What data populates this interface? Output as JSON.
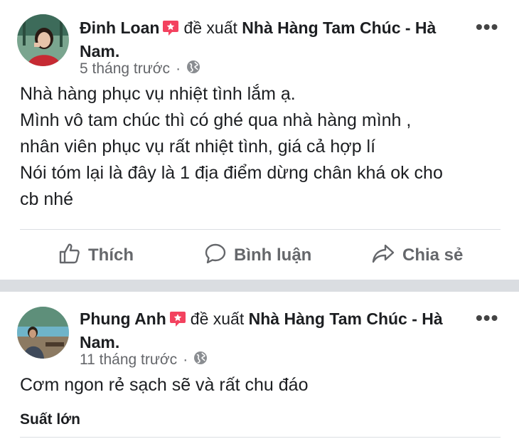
{
  "posts": [
    {
      "author": "Đinh Loan",
      "verb": "đề xuất",
      "place": "Nhà Hàng Tam Chúc - Hà Nam.",
      "time": "5 tháng trước",
      "separator": "·",
      "icons": {
        "recommend": "recommend-badge-icon",
        "privacy": "globe-icon",
        "more": "more-options-icon"
      },
      "body_lines": [
        "Nhà hàng phục vụ nhiệt tình lắm ạ.",
        "Mình vô tam chúc thì có ghé qua nhà hàng mình ,",
        "nhân viên phục vụ rất nhiệt tình, giá cả hợp lí",
        "Nói tóm lại là đây là 1 địa điểm dừng chân khá ok cho",
        "cb nhé"
      ]
    },
    {
      "author": "Phung Anh",
      "verb": "đề xuất",
      "place": "Nhà Hàng Tam Chúc - Hà Nam.",
      "time": "11 tháng trước",
      "separator": "·",
      "icons": {
        "recommend": "recommend-badge-icon",
        "privacy": "globe-icon",
        "more": "more-options-icon"
      },
      "body_lines": [
        "Cơm ngon rẻ sạch sẽ và rất chu đáo"
      ],
      "see_more": "Suất lớn"
    }
  ],
  "actions": {
    "like": "Thích",
    "comment": "Bình luận",
    "share": "Chia sẻ",
    "icons": {
      "like": "thumbs-up-icon",
      "comment": "comment-bubble-icon",
      "share": "share-arrow-icon"
    }
  },
  "colors": {
    "recommend_badge": "#f3425f",
    "secondary_text": "#65676b",
    "divider": "#dadde1"
  }
}
